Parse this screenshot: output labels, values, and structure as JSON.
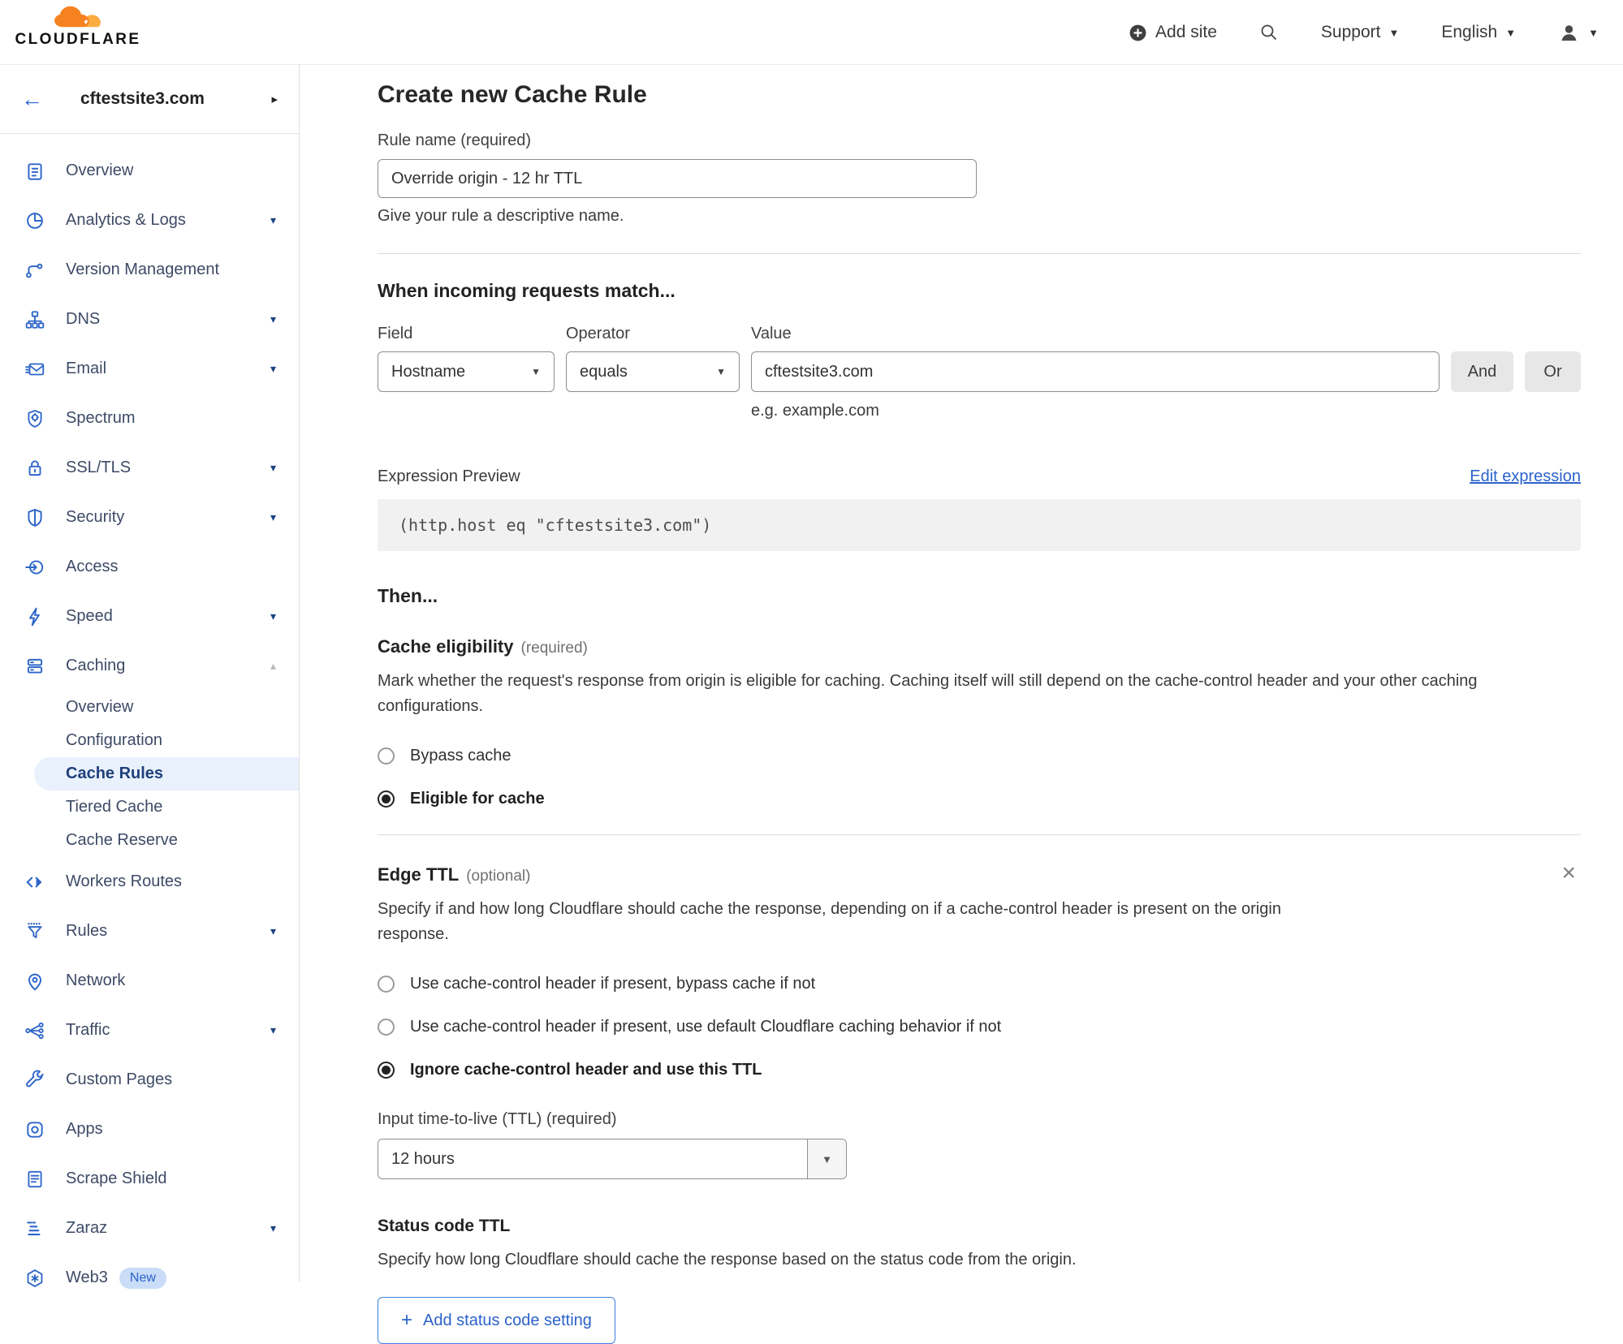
{
  "glyphs": {
    "back_arrow": "←",
    "expand_right": "▸",
    "caret_down": "▾",
    "caret_up": "▴",
    "select_caret": "▼",
    "close": "×",
    "plus": "+"
  },
  "colors": {
    "accent_blue": "#2c62cb",
    "nav_icon_blue": "#2e66c9",
    "brand_orange": "#f6821f",
    "brand_orange_light": "#fbad41",
    "active_item_bg": "#e9f1fc"
  },
  "header": {
    "brand": "CLOUDFLARE",
    "add_site_label": "Add site",
    "support_label": "Support",
    "language_label": "English",
    "icons": [
      "add-site-icon",
      "search-icon",
      "user-icon"
    ]
  },
  "sidebar": {
    "site_name": "cftestsite3.com",
    "items": [
      {
        "label": "Overview",
        "chevron": false
      },
      {
        "label": "Analytics & Logs",
        "chevron": true
      },
      {
        "label": "Version Management",
        "chevron": false
      },
      {
        "label": "DNS",
        "chevron": true
      },
      {
        "label": "Email",
        "chevron": true
      },
      {
        "label": "Spectrum",
        "chevron": false
      },
      {
        "label": "SSL/TLS",
        "chevron": true
      },
      {
        "label": "Security",
        "chevron": true
      },
      {
        "label": "Access",
        "chevron": false
      },
      {
        "label": "Speed",
        "chevron": true
      },
      {
        "label": "Caching",
        "chevron": true,
        "expanded": true
      },
      {
        "label": "Workers Routes",
        "chevron": false
      },
      {
        "label": "Rules",
        "chevron": true
      },
      {
        "label": "Network",
        "chevron": false
      },
      {
        "label": "Traffic",
        "chevron": true
      },
      {
        "label": "Custom Pages",
        "chevron": false
      },
      {
        "label": "Apps",
        "chevron": false
      },
      {
        "label": "Scrape Shield",
        "chevron": false
      },
      {
        "label": "Zaraz",
        "chevron": true
      },
      {
        "label": "Web3",
        "chevron": false,
        "badge": "New"
      }
    ],
    "caching_sub": [
      {
        "label": "Overview",
        "active": false
      },
      {
        "label": "Configuration",
        "active": false
      },
      {
        "label": "Cache Rules",
        "active": true
      },
      {
        "label": "Tiered Cache",
        "active": false
      },
      {
        "label": "Cache Reserve",
        "active": false
      }
    ]
  },
  "main": {
    "title": "Create new Cache Rule",
    "rule_name": {
      "label": "Rule name (required)",
      "value": "Override origin - 12 hr TTL",
      "help": "Give your rule a descriptive name."
    },
    "match": {
      "heading": "When incoming requests match...",
      "field_label": "Field",
      "operator_label": "Operator",
      "value_label": "Value",
      "field_value": "Hostname",
      "operator_value": "equals",
      "value_value": "cftestsite3.com",
      "value_help": "e.g. example.com",
      "and_label": "And",
      "or_label": "Or"
    },
    "expression": {
      "label": "Expression Preview",
      "edit_link": "Edit expression",
      "code": "(http.host eq \"cftestsite3.com\")"
    },
    "then_heading": "Then...",
    "cache_eligibility": {
      "heading": "Cache eligibility",
      "required_tag": "(required)",
      "description": "Mark whether the request's response from origin is eligible for caching. Caching itself will still depend on the cache-control header and your other caching configurations.",
      "options": [
        {
          "label": "Bypass cache",
          "selected": false
        },
        {
          "label": "Eligible for cache",
          "selected": true
        }
      ]
    },
    "edge_ttl": {
      "heading": "Edge TTL",
      "optional_tag": "(optional)",
      "description": "Specify if and how long Cloudflare should cache the response, depending on if a cache-control header is present on the origin response.",
      "options": [
        {
          "label": "Use cache-control header if present, bypass cache if not",
          "selected": false
        },
        {
          "label": "Use cache-control header if present, use default Cloudflare caching behavior if not",
          "selected": false
        },
        {
          "label": "Ignore cache-control header and use this TTL",
          "selected": true
        }
      ],
      "ttl_label": "Input time-to-live (TTL) (required)",
      "ttl_value": "12 hours"
    },
    "status_code_ttl": {
      "heading": "Status code TTL",
      "description": "Specify how long Cloudflare should cache the response based on the status code from the origin.",
      "add_button_label": "Add status code setting"
    }
  }
}
